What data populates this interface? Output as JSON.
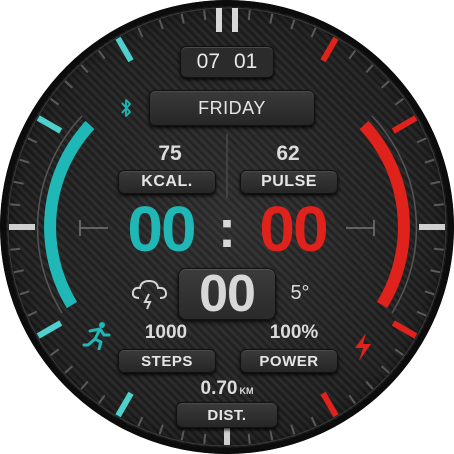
{
  "date": {
    "month": "07",
    "day": "01"
  },
  "weekday": "FRIDAY",
  "calories": {
    "value": "75",
    "label": "KCAL."
  },
  "pulse": {
    "value": "62",
    "label": "PULSE"
  },
  "time": {
    "hours": "00",
    "separator": ":",
    "minutes": "00"
  },
  "weather": {
    "value": "00",
    "temperature": "5°",
    "icon": "thunderstorm-cloud-icon"
  },
  "steps": {
    "value": "1000",
    "label": "STEPS",
    "icon": "runner-icon"
  },
  "power": {
    "value": "100%",
    "label": "POWER",
    "icon": "lightning-icon"
  },
  "distance": {
    "value": "0.70",
    "unit": "KM",
    "label": "DIST."
  },
  "icons": {
    "bluetooth": "bluetooth-icon"
  },
  "colors": {
    "teal": "#1fb8b6",
    "red": "#e0221c",
    "text": "#e6e6e6"
  },
  "gauges": {
    "steps_level": 1.0,
    "power_level": 1.0
  }
}
